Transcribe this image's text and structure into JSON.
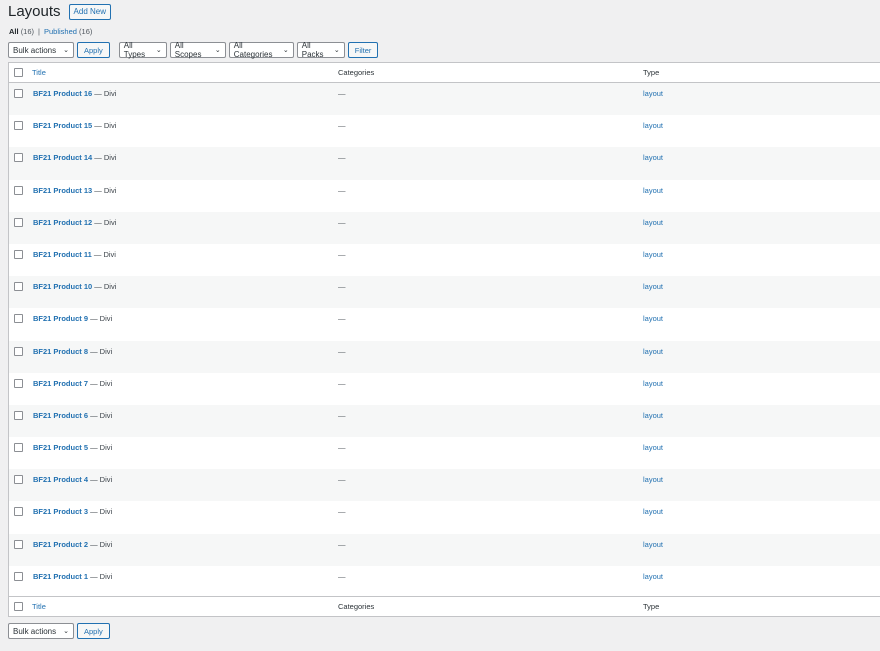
{
  "header": {
    "title": "Layouts",
    "add_new_label": "Add New"
  },
  "views": {
    "all_label": "All",
    "all_count": "(16)",
    "separator": "|",
    "published_label": "Published",
    "published_count": "(16)"
  },
  "tablenav_top": {
    "bulk_actions": "Bulk actions",
    "apply": "Apply",
    "types": "All Types",
    "scopes": "All Scopes",
    "categories": "All Categories",
    "packs": "All Packs",
    "filter": "Filter"
  },
  "tablenav_bottom": {
    "bulk_actions": "Bulk actions",
    "apply": "Apply"
  },
  "columns": {
    "title": "Title",
    "categories": "Categories",
    "type": "Type"
  },
  "rows": [
    {
      "name": "BF21 Product 16",
      "suffix": " — Divi",
      "categories": "—",
      "type": "layout"
    },
    {
      "name": "BF21 Product 15",
      "suffix": " — Divi",
      "categories": "—",
      "type": "layout"
    },
    {
      "name": "BF21 Product 14",
      "suffix": " — Divi",
      "categories": "—",
      "type": "layout"
    },
    {
      "name": "BF21 Product 13",
      "suffix": " — Divi",
      "categories": "—",
      "type": "layout"
    },
    {
      "name": "BF21 Product 12",
      "suffix": " — Divi",
      "categories": "—",
      "type": "layout"
    },
    {
      "name": "BF21 Product 11",
      "suffix": " — Divi",
      "categories": "—",
      "type": "layout"
    },
    {
      "name": "BF21 Product 10",
      "suffix": " — Divi",
      "categories": "—",
      "type": "layout"
    },
    {
      "name": "BF21 Product 9",
      "suffix": " — Divi",
      "categories": "—",
      "type": "layout"
    },
    {
      "name": "BF21 Product 8",
      "suffix": " — Divi",
      "categories": "—",
      "type": "layout"
    },
    {
      "name": "BF21 Product 7",
      "suffix": " — Divi",
      "categories": "—",
      "type": "layout"
    },
    {
      "name": "BF21 Product 6",
      "suffix": " — Divi",
      "categories": "—",
      "type": "layout"
    },
    {
      "name": "BF21 Product 5",
      "suffix": " — Divi",
      "categories": "—",
      "type": "layout"
    },
    {
      "name": "BF21 Product 4",
      "suffix": " — Divi",
      "categories": "—",
      "type": "layout"
    },
    {
      "name": "BF21 Product 3",
      "suffix": " — Divi",
      "categories": "—",
      "type": "layout"
    },
    {
      "name": "BF21 Product 2",
      "suffix": " — Divi",
      "categories": "—",
      "type": "layout"
    },
    {
      "name": "BF21 Product 1",
      "suffix": " — Divi",
      "categories": "—",
      "type": "layout"
    }
  ],
  "icons": {
    "dropdown": "chevron-down-icon",
    "checkbox": "checkbox-icon"
  },
  "colors": {
    "link": "#2271b1",
    "background": "#f0f0f1",
    "border": "#c3c4c7"
  }
}
